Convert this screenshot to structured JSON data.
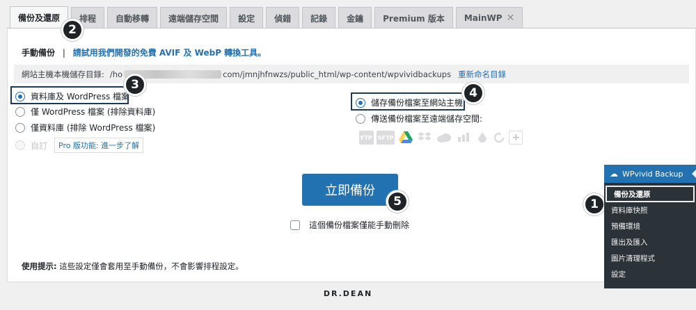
{
  "tabs": [
    "備份及還原",
    "排程",
    "自動移轉",
    "遠端儲存空間",
    "設定",
    "偵錯",
    "記錄",
    "金鑰",
    "Premium 版本",
    "MainWP"
  ],
  "tab_close": "✕",
  "header": {
    "title": "手動備份",
    "separator": "|",
    "promo": "請試用我們開發的免費 AVIF 及 WebP 轉換工具。"
  },
  "path": {
    "label": "網站主機本機儲存目錄:",
    "prefix": "/ho",
    "suffix": "com/jmnjhfnwzs/public_html/wp-content/wpvividbackups",
    "rename": "重新命名目錄"
  },
  "backup_options": [
    {
      "label": "資料庫及 WordPress 檔案",
      "selected": true
    },
    {
      "label": "僅 WordPress 檔案 (排除資料庫)",
      "selected": false
    },
    {
      "label": "僅資料庫 (排除 WordPress 檔案)",
      "selected": false
    },
    {
      "label": "自訂",
      "selected": false,
      "disabled": true
    }
  ],
  "pro_feature": "Pro 版功能: 進一步了解",
  "destination_options": [
    {
      "label": "儲存備份檔案至網站主機",
      "selected": true
    },
    {
      "label": "傳送備份檔案至遠端儲存空間:",
      "selected": false
    }
  ],
  "storage_icons": [
    "ftp-icon",
    "sftp-icon",
    "google-drive-icon",
    "dropbox-icon",
    "onedrive-icon",
    "s3-icon",
    "backblaze-icon",
    "refresh-icon",
    "add-storage-icon"
  ],
  "storage_labels": {
    "ftp": "FTP",
    "sftp": "SFTP",
    "plus": "+"
  },
  "backup_button": "立即備份",
  "manual_delete_label": "這個備份檔案僅能手動刪除",
  "tip": {
    "prefix": "使用提示:",
    "text": " 這些設定僅會套用至手動備份，不會影響排程設定。"
  },
  "sidebar": {
    "title": "WPvivid Backup",
    "items": [
      "備份及還原",
      "資料庫快照",
      "預備環境",
      "匯出及匯入",
      "圖片清理程式",
      "設定"
    ]
  },
  "badges": [
    "1",
    "2",
    "3",
    "4",
    "5"
  ],
  "footer": "DR.DEAN",
  "colors": {
    "accent": "#2271b1",
    "badge": "#1d2327",
    "sidebar": "#2c3338"
  }
}
